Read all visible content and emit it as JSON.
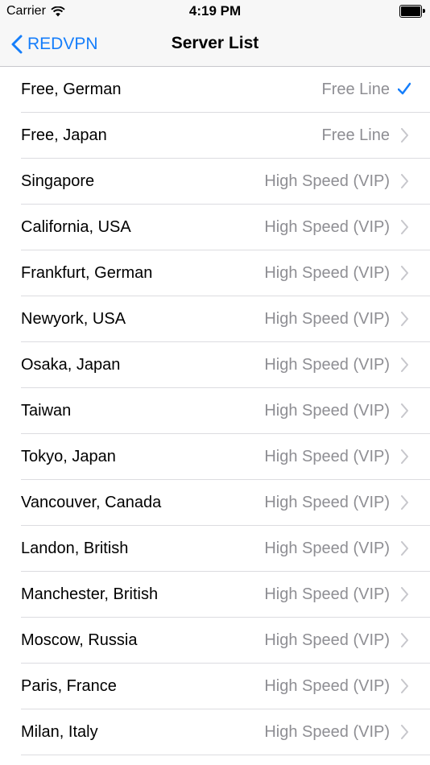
{
  "status_bar": {
    "carrier": "Carrier",
    "time": "4:19 PM"
  },
  "nav": {
    "back_label": "REDVPN",
    "title": "Server List"
  },
  "colors": {
    "accent": "#157efb",
    "detail_text": "#8e8e93",
    "separator": "#dcdce0",
    "bar_background": "#f7f7f7"
  },
  "servers": [
    {
      "name": "Free, German",
      "detail": "Free Line",
      "selected": true
    },
    {
      "name": "Free, Japan",
      "detail": "Free Line",
      "selected": false
    },
    {
      "name": "Singapore",
      "detail": "High Speed (VIP)",
      "selected": false
    },
    {
      "name": "California, USA",
      "detail": "High Speed (VIP)",
      "selected": false
    },
    {
      "name": "Frankfurt, German",
      "detail": "High Speed (VIP)",
      "selected": false
    },
    {
      "name": "Newyork, USA",
      "detail": "High Speed (VIP)",
      "selected": false
    },
    {
      "name": "Osaka, Japan",
      "detail": "High Speed (VIP)",
      "selected": false
    },
    {
      "name": "Taiwan",
      "detail": "High Speed (VIP)",
      "selected": false
    },
    {
      "name": "Tokyo, Japan",
      "detail": "High Speed (VIP)",
      "selected": false
    },
    {
      "name": "Vancouver, Canada",
      "detail": "High Speed (VIP)",
      "selected": false
    },
    {
      "name": "Landon, British",
      "detail": "High Speed (VIP)",
      "selected": false
    },
    {
      "name": "Manchester, British",
      "detail": "High Speed (VIP)",
      "selected": false
    },
    {
      "name": "Moscow, Russia",
      "detail": "High Speed (VIP)",
      "selected": false
    },
    {
      "name": "Paris, France",
      "detail": "High Speed (VIP)",
      "selected": false
    },
    {
      "name": "Milan, Italy",
      "detail": "High Speed (VIP)",
      "selected": false
    }
  ]
}
